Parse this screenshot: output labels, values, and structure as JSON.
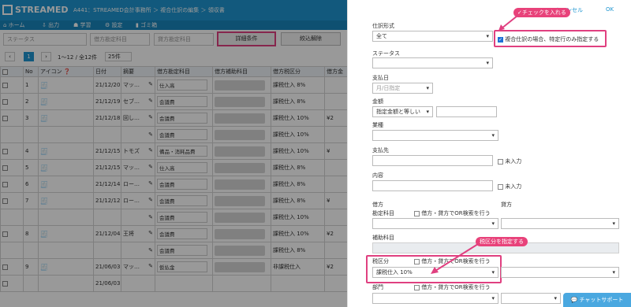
{
  "app": {
    "logo": "STREAMED",
    "breadcrumb": "A441：STREAMED会計事務所 ＞ 複合仕訳の編集 ＞ 領収書"
  },
  "nav": [
    "ホーム",
    "出力",
    "学習",
    "設定",
    "ゴミ箱"
  ],
  "filter": {
    "status": "ステータス",
    "debit": "借方勘定科目",
    "credit": "貸方勘定科目",
    "detail_btn": "詳細条件",
    "reset_btn": "絞込解除"
  },
  "paging": {
    "prev": "‹",
    "page": "1",
    "next": "›",
    "range": "1〜12 / 全12件",
    "per": "25件"
  },
  "table": {
    "headers": [
      "",
      "No",
      "アイコン",
      "日付",
      "摘要",
      "借方勘定科目",
      "借方補助科目",
      "借方税区分",
      "借方金"
    ],
    "rows": [
      {
        "no": "1",
        "date": "21/12/20",
        "memo": "マッ…",
        "acct": "仕入高",
        "tax": "課税仕入 8%",
        "amt": ""
      },
      {
        "no": "2",
        "date": "21/12/19",
        "memo": "セブ…",
        "acct": "会議費",
        "tax": "課税仕入 8%",
        "amt": ""
      },
      {
        "no": "3",
        "date": "21/12/18",
        "memo": "回し…",
        "acct": "会議費",
        "tax": "課税仕入 10%",
        "amt": "¥2"
      },
      {
        "no": "",
        "date": "",
        "memo": "",
        "acct": "会議費",
        "tax": "課税仕入 10%",
        "amt": ""
      },
      {
        "no": "4",
        "date": "21/12/15",
        "memo": "トモズ",
        "acct": "備品・消耗品費",
        "tax": "課税仕入 10%",
        "amt": "¥"
      },
      {
        "no": "5",
        "date": "21/12/15",
        "memo": "マッ…",
        "acct": "仕入高",
        "tax": "課税仕入 8%",
        "amt": ""
      },
      {
        "no": "6",
        "date": "21/12/14",
        "memo": "ロー…",
        "acct": "会議費",
        "tax": "課税仕入 8%",
        "amt": ""
      },
      {
        "no": "7",
        "date": "21/12/12",
        "memo": "ロー…",
        "acct": "会議費",
        "tax": "課税仕入 8%",
        "amt": "¥"
      },
      {
        "no": "",
        "date": "",
        "memo": "",
        "acct": "会議費",
        "tax": "課税仕入 10%",
        "amt": ""
      },
      {
        "no": "8",
        "date": "21/12/04",
        "memo": "王将",
        "acct": "会議費",
        "tax": "課税仕入 10%",
        "amt": "¥2"
      },
      {
        "no": "",
        "date": "",
        "memo": "",
        "acct": "会議費",
        "tax": "課税仕入 8%",
        "amt": ""
      },
      {
        "no": "9",
        "date": "21/06/03",
        "memo": "マッ…",
        "acct": "仮払金",
        "tax": "非課税仕入",
        "amt": "¥2"
      },
      {
        "no": "",
        "date": "21/06/03",
        "memo": "",
        "acct": "",
        "tax": "",
        "amt": ""
      }
    ]
  },
  "panel": {
    "cancel": "キャンセル",
    "ok": "OK",
    "entry_type_label": "仕訳形式",
    "entry_type_value": "全て",
    "compound_only": "複合仕訳の場合、特定行のみ指定する",
    "status_label": "ステータス",
    "paydate_label": "支払日",
    "paydate_ph": "月/日指定",
    "amount_label": "金額",
    "amount_value": "指定金額と等しい",
    "industry_label": "業種",
    "payee_label": "支払先",
    "unfilled": "未入力",
    "content_label": "内容",
    "debit_label": "借方",
    "credit_label": "貸方",
    "acct_label": "勘定科目",
    "or_search": "借方・貸方でOR検索を行う",
    "sub_label": "補助科目",
    "tax_label": "税区分",
    "tax_value": "課税仕入 10%",
    "dept_label": "部門"
  },
  "annotations": {
    "check_note": "✓チェックを入れる",
    "tax_note": "税区分を指定する"
  },
  "chat": "チャットサポート",
  "colors": {
    "brand": "#1e95d0",
    "highlight": "#e04080"
  }
}
